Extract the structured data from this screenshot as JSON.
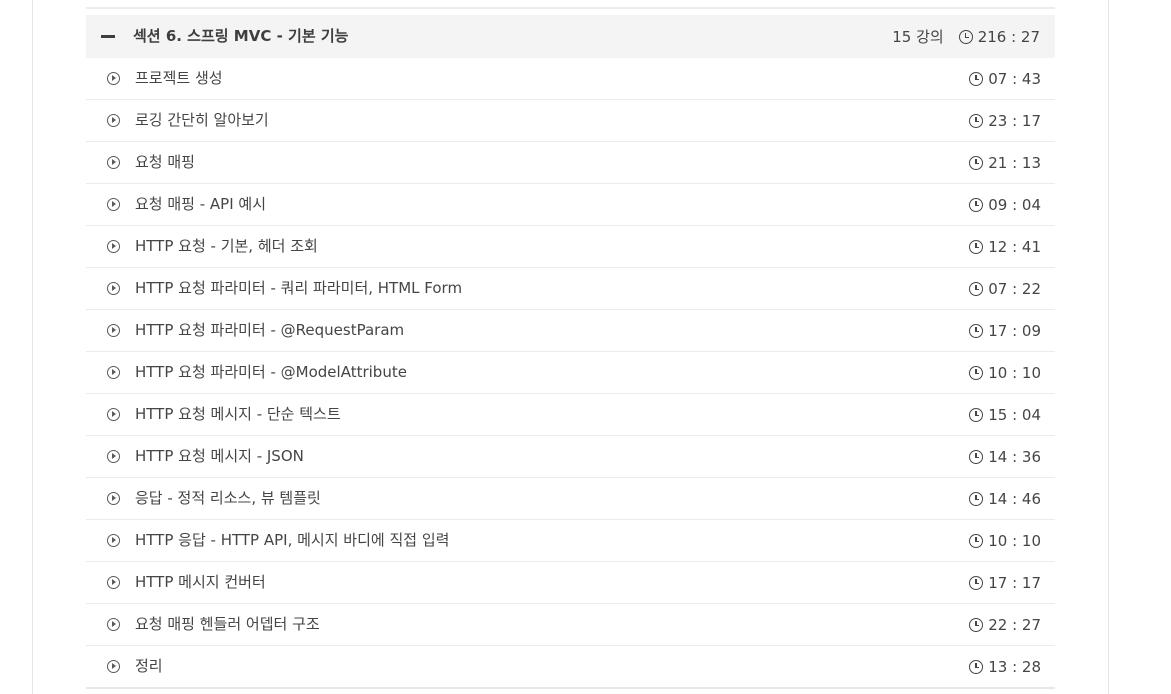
{
  "section": {
    "title": "섹션 6. 스프링 MVC - 기본 기능",
    "lecture_count": "15 강의",
    "total_time": "216 : 27"
  },
  "lectures": [
    {
      "title": "프로젝트 생성",
      "time": "07 : 43"
    },
    {
      "title": "로깅 간단히 알아보기",
      "time": "23 : 17"
    },
    {
      "title": "요청 매핑",
      "time": "21 : 13"
    },
    {
      "title": "요청 매핑 - API 예시",
      "time": "09 : 04"
    },
    {
      "title": "HTTP 요청 - 기본, 헤더 조회",
      "time": "12 : 41"
    },
    {
      "title": "HTTP 요청 파라미터 - 쿼리 파라미터, HTML Form",
      "time": "07 : 22"
    },
    {
      "title": "HTTP 요청 파라미터 - @RequestParam",
      "time": "17 : 09"
    },
    {
      "title": "HTTP 요청 파라미터 - @ModelAttribute",
      "time": "10 : 10"
    },
    {
      "title": "HTTP 요청 메시지 - 단순 텍스트",
      "time": "15 : 04"
    },
    {
      "title": "HTTP 요청 메시지 - JSON",
      "time": "14 : 36"
    },
    {
      "title": "응답 - 정적 리소스, 뷰 템플릿",
      "time": "14 : 46"
    },
    {
      "title": "HTTP 응답 - HTTP API, 메시지 바디에 직접 입력",
      "time": "10 : 10"
    },
    {
      "title": "HTTP 메시지 컨버터",
      "time": "17 : 17"
    },
    {
      "title": "요청 매핑 헨들러 어뎁터 구조",
      "time": "22 : 27"
    },
    {
      "title": "정리",
      "time": "13 : 28"
    }
  ],
  "icons": {
    "collapse": "minus-icon",
    "duration": "clock-icon",
    "lecture": "play-circle-icon"
  }
}
